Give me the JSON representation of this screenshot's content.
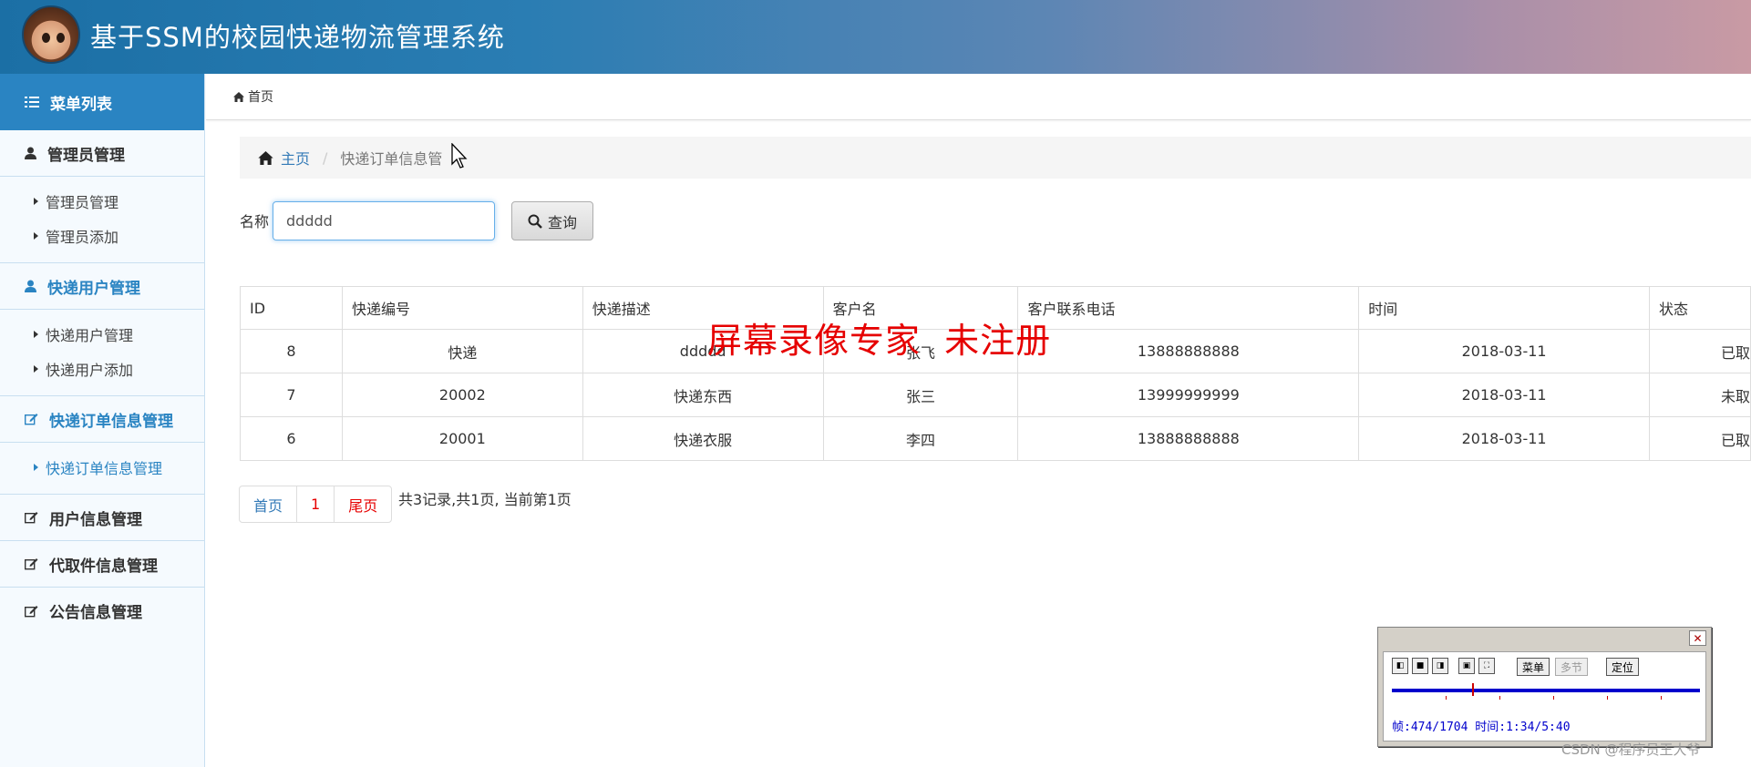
{
  "header": {
    "title": "基于SSM的校园快递物流管理系统"
  },
  "sidebar": {
    "menu_title": "菜单列表",
    "groups": [
      {
        "label": "管理员管理",
        "items": [
          "管理员管理",
          "管理员添加"
        ]
      },
      {
        "label": "快递用户管理",
        "items": [
          "快递用户管理",
          "快递用户添加"
        ]
      },
      {
        "label": "快递订单信息管理",
        "items": [
          "快递订单信息管理"
        ]
      },
      {
        "label": "用户信息管理"
      },
      {
        "label": "代取件信息管理"
      },
      {
        "label": "公告信息管理"
      }
    ]
  },
  "topnav": {
    "home": "首页"
  },
  "breadcrumb": {
    "home": "主页",
    "separator": "/",
    "current": "快递订单信息管"
  },
  "search": {
    "label": "名称",
    "value": "ddddd",
    "button": "查询"
  },
  "table": {
    "headers": [
      "ID",
      "快递编号",
      "快递描述",
      "客户名",
      "客户联系电话",
      "时间",
      "状态"
    ],
    "rows": [
      [
        "8",
        "快递",
        "ddddd",
        "张飞",
        "13888888888",
        "2018-03-11",
        "已取"
      ],
      [
        "7",
        "20002",
        "快递东西",
        "张三",
        "13999999999",
        "2018-03-11",
        "未取"
      ],
      [
        "6",
        "20001",
        "快递衣服",
        "李四",
        "13888888888",
        "2018-03-11",
        "已取"
      ]
    ]
  },
  "pagination": {
    "first": "首页",
    "page": "1",
    "last": "尾页",
    "info": "共3记录,共1页, 当前第1页"
  },
  "watermark": "屏幕录像专家  未注册",
  "recorder": {
    "menu": "菜单",
    "section": "多节",
    "locate": "定位",
    "status": "帧:474/1704 时间:1:34/5:40"
  },
  "footer": {
    "credit": "CSDN @程序员王大爷"
  },
  "colors": {
    "accent": "#2a84c2",
    "link": "#337ab7",
    "watermark": "#e60000"
  }
}
